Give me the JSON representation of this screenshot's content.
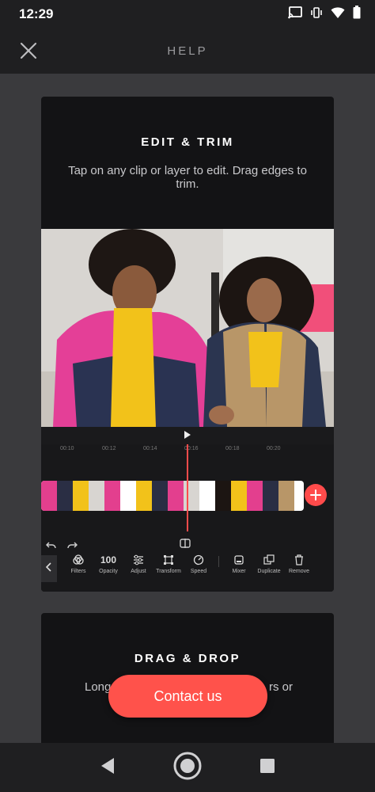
{
  "status_bar": {
    "time": "12:29",
    "icons": [
      "cast-icon",
      "vibrate-icon",
      "wifi-icon",
      "battery-icon"
    ]
  },
  "header": {
    "title": "HELP",
    "close_icon": "close-icon"
  },
  "cards": [
    {
      "title": "EDIT & TRIM",
      "description": "Tap on any clip or layer to edit. Drag edges to trim.",
      "timeline_ticks": [
        "00:10",
        "00:12",
        "00:14",
        "00:16",
        "00:18",
        "00:20"
      ],
      "tools": [
        {
          "label": "Filters",
          "icon": "filters-icon"
        },
        {
          "label": "Opacity",
          "value": "100"
        },
        {
          "label": "Adjust",
          "icon": "adjust-icon"
        },
        {
          "label": "Transform",
          "icon": "transform-icon"
        },
        {
          "label": "Speed",
          "icon": "speed-icon"
        },
        {
          "label": "Mixer",
          "icon": "mixer-icon"
        },
        {
          "label": "Duplicate",
          "icon": "duplicate-icon"
        },
        {
          "label": "Remove",
          "icon": "remove-icon"
        }
      ]
    },
    {
      "title": "DRAG & DROP",
      "description_visible_left": "Long",
      "description_visible_right": "rs or"
    }
  ],
  "contact_button": {
    "label": "Contact us"
  },
  "nav_bar": {
    "icons": [
      "back-icon",
      "home-icon",
      "recents-icon"
    ]
  },
  "colors": {
    "accent": "#ff524b",
    "background": "#3a3a3d",
    "card": "#131315"
  }
}
